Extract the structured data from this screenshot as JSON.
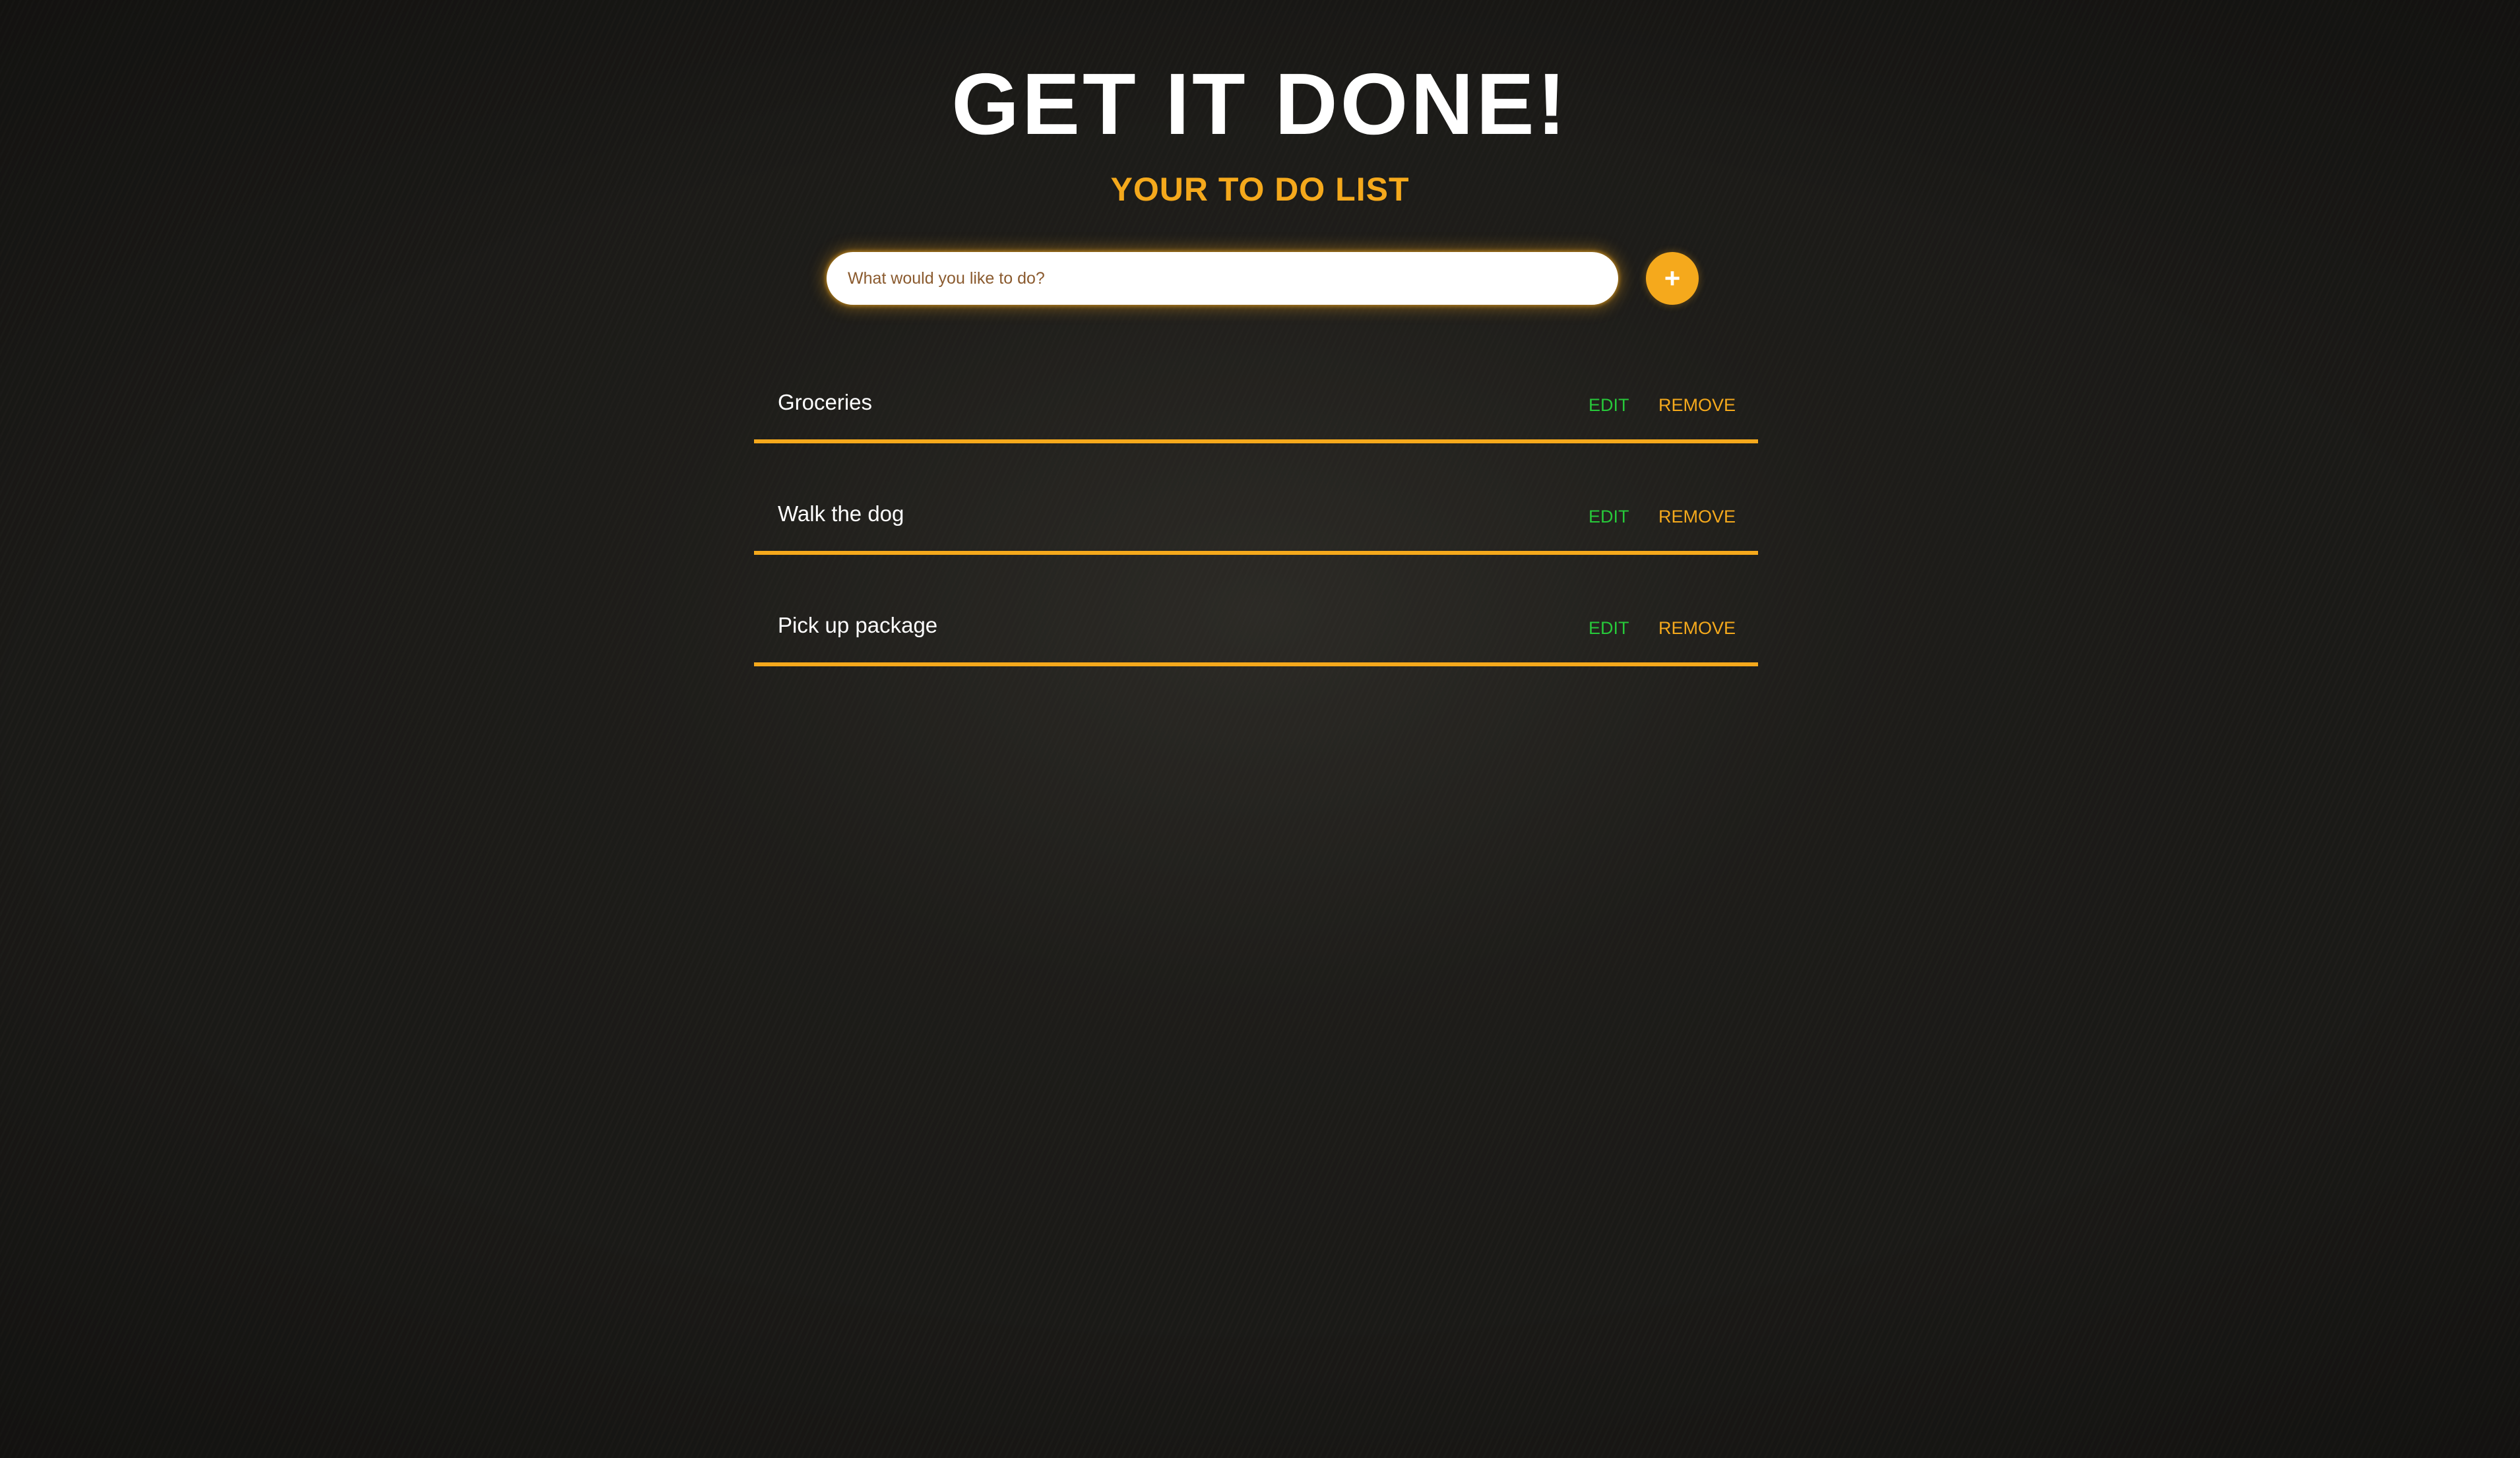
{
  "header": {
    "title": "GET IT DONE!",
    "subtitle": "YOUR TO DO LIST"
  },
  "new_task": {
    "value": "",
    "placeholder": "What would you like to do?",
    "add_label": "+"
  },
  "todos": [
    {
      "text": "Groceries",
      "edit_label": "EDIT",
      "remove_label": "REMOVE"
    },
    {
      "text": "Walk the dog",
      "edit_label": "EDIT",
      "remove_label": "REMOVE"
    },
    {
      "text": "Pick up package",
      "edit_label": "EDIT",
      "remove_label": "REMOVE"
    }
  ],
  "colors": {
    "accent": "#f5a91c",
    "edit": "#27c93a",
    "text": "#ffffff",
    "background": "#1b1a17"
  },
  "icons": {
    "add": "plus-icon"
  }
}
